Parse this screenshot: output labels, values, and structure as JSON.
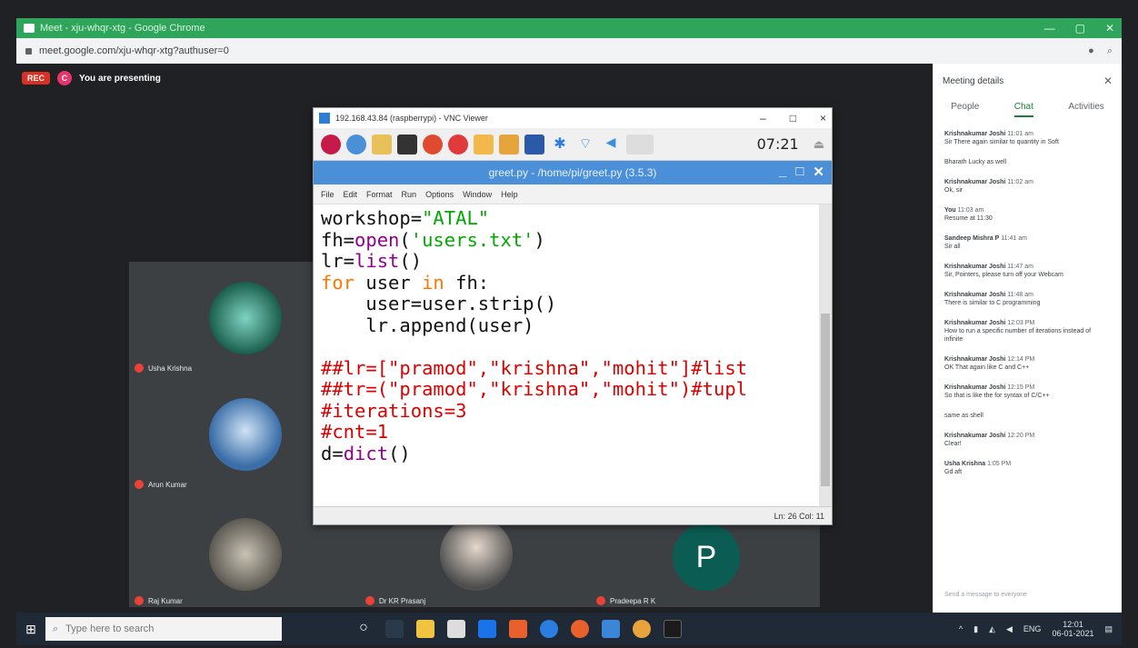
{
  "browser": {
    "tab_title": "Meet - xju-whqr-xtg - Google Chrome",
    "url": "meet.google.com/xju-whqr-xtg?authuser=0",
    "window_controls": [
      "—",
      "▢",
      "✕"
    ]
  },
  "meet": {
    "rec_badge": "REC",
    "presenter_initial": "C",
    "presenting_text": "You are presenting",
    "participants": [
      {
        "name": "Usha Krishna"
      },
      {
        "name": "Arun Kumar"
      },
      {
        "name": "Raj Kumar"
      },
      {
        "name": "Dr KR Prasanj"
      },
      {
        "name": "Pradeepa R K",
        "initial": "P"
      }
    ]
  },
  "vnc": {
    "title": "192.168.43.84 (raspberrypi) - VNC Viewer",
    "clock": "07:21",
    "idle_title": "greet.py - /home/pi/greet.py (3.5.3)",
    "menu": [
      "File",
      "Edit",
      "Format",
      "Run",
      "Options",
      "Window",
      "Help"
    ],
    "status": "Ln: 26   Col: 11",
    "code": {
      "l1a": "workshop=",
      "l1b": "\"ATAL\"",
      "l2a": "fh=",
      "l2b": "open",
      "l2c": "(",
      "l2d": "'users.txt'",
      "l2e": ")",
      "l3a": "lr=",
      "l3b": "list",
      "l3c": "()",
      "l4a": "for",
      "l4b": " user ",
      "l4c": "in",
      "l4d": " fh:",
      "l5": "    user=user.strip()",
      "l6": "    lr.append(user)",
      "l7": "##lr=[\"pramod\",\"krishna\",\"mohit\"]#list",
      "l8": "##tr=(\"pramod\",\"krishna\",\"mohit\")#tupl",
      "l9": "#iterations=3",
      "l10": "#cnt=1",
      "l11a": "d=",
      "l11b": "dict",
      "l11c": "()"
    }
  },
  "panel": {
    "title": "Meeting details",
    "tabs": [
      "People",
      "Chat",
      "Activities"
    ],
    "messages": [
      {
        "author": "Krishnakumar Joshi",
        "time": "11:01 am",
        "body": "Sir There again similar to quantity in Soft"
      },
      {
        "author": "",
        "time": "",
        "body": "Bharath Lucky as well"
      },
      {
        "author": "Krishnakumar Joshi",
        "time": "11:02 am",
        "body": "Ok, sir"
      },
      {
        "author": "You",
        "time": "11:03 am",
        "body": "Resume at 11:30"
      },
      {
        "author": "Sandeep Mishra P",
        "time": "11:41 am",
        "body": "Sir all"
      },
      {
        "author": "Krishnakumar Joshi",
        "time": "11:47 am",
        "body": "Sir, Pointers, please turn off your Webcam"
      },
      {
        "author": "Krishnakumar Joshi",
        "time": "11:48 am",
        "body": "There is similar to C programming"
      },
      {
        "author": "Krishnakumar Joshi",
        "time": "12:03 PM",
        "body": "How to run a specific number of iterations instead of infinite"
      },
      {
        "author": "Krishnakumar Joshi",
        "time": "12:14 PM",
        "body": "OK That again like C and C++"
      },
      {
        "author": "Krishnakumar Joshi",
        "time": "12:15 PM",
        "body": "So that is like the for syntax of C/C++"
      },
      {
        "author": "",
        "time": "",
        "body": "same as shell"
      },
      {
        "author": "Krishnakumar Joshi",
        "time": "12:20 PM",
        "body": "Clear!"
      },
      {
        "author": "Usha Krishna",
        "time": "1:05 PM",
        "body": "Gd aft"
      }
    ],
    "send_placeholder": "Send a message to everyone"
  },
  "taskbar": {
    "search_placeholder": "Type here to search",
    "time": "12:01",
    "date": "06-01-2021",
    "lang": "ENG"
  }
}
